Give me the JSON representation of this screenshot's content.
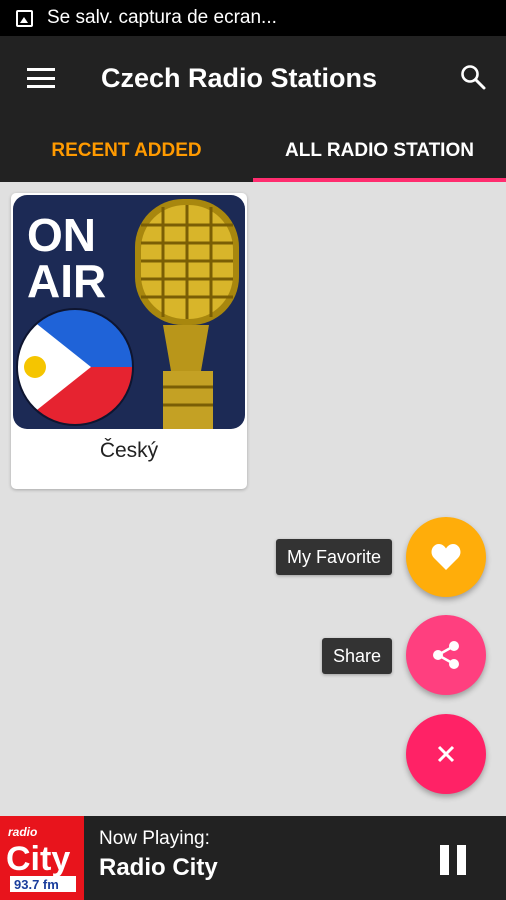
{
  "status_bar": {
    "notification": "Se salv. captura de ecran..."
  },
  "app_bar": {
    "title": "Czech Radio Stations"
  },
  "tabs": [
    {
      "label": "RECENT ADDED",
      "active": false
    },
    {
      "label": "ALL RADIO STATION",
      "active": true
    }
  ],
  "stations": [
    {
      "name": "Český",
      "artwork_text": "ON AIR"
    }
  ],
  "fab_menu": {
    "favorite_label": "My Favorite",
    "share_label": "Share"
  },
  "player": {
    "now_playing_label": "Now Playing:",
    "station_name": "Radio City",
    "logo_text": {
      "top": "radio",
      "main": "City",
      "freq": "93.7 fm"
    }
  },
  "colors": {
    "accent_orange": "#ff9a00",
    "accent_pink": "#ff2d6f",
    "fab_favorite": "#ffad0a",
    "fab_share": "#ff3f7f",
    "fab_close": "#ff2266",
    "app_bar": "#222222"
  },
  "icons": {
    "status": "image-icon",
    "menu": "menu-icon",
    "search": "search-icon",
    "favorite": "heart-icon",
    "share": "share-icon",
    "close": "close-icon",
    "player_control": "pause-icon"
  }
}
